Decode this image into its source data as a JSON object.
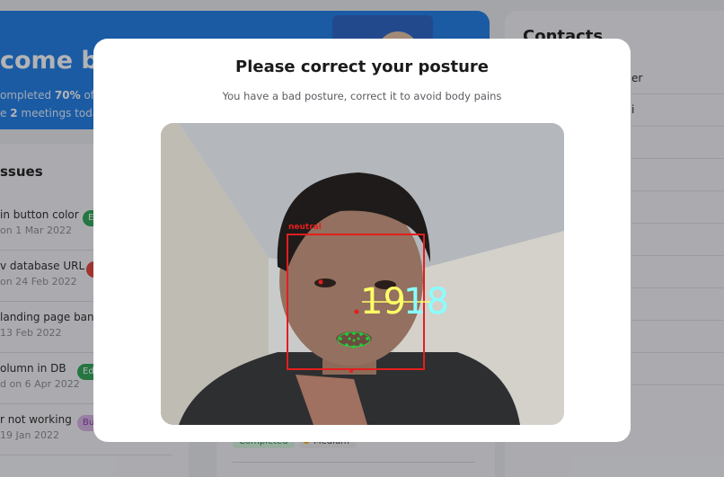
{
  "welcome": {
    "title": "come ba",
    "line1_prefix": "ompleted ",
    "line1_bold": "70%",
    "line1_suffix": " of yo",
    "line2_prefix": "e ",
    "line2_bold": "2",
    "line2_suffix": " meetings today"
  },
  "issues": {
    "title": "ssues",
    "items": [
      {
        "title": "in button color",
        "date": "on 1 Mar 2022",
        "badge": "E",
        "badge_color": "#2fa655"
      },
      {
        "title": "v database URL",
        "date": "on 24 Feb 2022",
        "badge": "",
        "badge_color": "#e0443a"
      },
      {
        "title": "landing page banne",
        "date": "13 Feb 2022",
        "badge": "",
        "badge_color": ""
      },
      {
        "title": "olumn in DB",
        "date": "d on 6 Apr 2022",
        "badge": "Ed",
        "badge_color": "#2fa655"
      },
      {
        "title": "r not working",
        "date": "19 Jan 2022",
        "badge": "Bu",
        "badge_color": "#c792d9"
      }
    ]
  },
  "task": {
    "status": "Completed",
    "priority": "Medium",
    "priority_color": "#f2b21e"
  },
  "contacts": {
    "title": "Contacts",
    "fragments": [
      "er",
      "i"
    ]
  },
  "modal": {
    "title": "Please correct your posture",
    "subtitle": "You have a bad posture, correct it to avoid body pains",
    "camera": {
      "emotion_label": "neutral",
      "overlay_number": "1918",
      "box_color": "#e51e1e",
      "number_colors": [
        "#ffff66",
        "#88ffff"
      ]
    }
  }
}
